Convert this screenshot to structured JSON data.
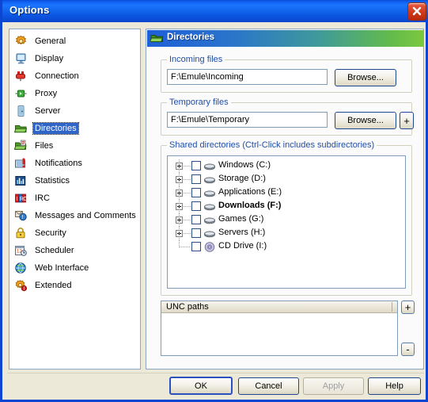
{
  "window": {
    "title": "Options",
    "close_icon": "close-x-icon"
  },
  "sidebar": {
    "items": [
      {
        "label": "General",
        "icon": "gear-icon",
        "selected": false
      },
      {
        "label": "Display",
        "icon": "monitor-icon",
        "selected": false
      },
      {
        "label": "Connection",
        "icon": "plug-icon",
        "selected": false
      },
      {
        "label": "Proxy",
        "icon": "proxy-icon",
        "selected": false
      },
      {
        "label": "Server",
        "icon": "server-icon",
        "selected": false
      },
      {
        "label": "Directories",
        "icon": "folder-icon",
        "selected": true
      },
      {
        "label": "Files",
        "icon": "files-icon",
        "selected": false
      },
      {
        "label": "Notifications",
        "icon": "notification-icon",
        "selected": false
      },
      {
        "label": "Statistics",
        "icon": "statistics-icon",
        "selected": false
      },
      {
        "label": "IRC",
        "icon": "irc-icon",
        "selected": false
      },
      {
        "label": "Messages and Comments",
        "icon": "messages-icon",
        "selected": false
      },
      {
        "label": "Security",
        "icon": "lock-icon",
        "selected": false
      },
      {
        "label": "Scheduler",
        "icon": "calendar-clock-icon",
        "selected": false
      },
      {
        "label": "Web Interface",
        "icon": "globe-icon",
        "selected": false
      },
      {
        "label": "Extended",
        "icon": "gear-alert-icon",
        "selected": false
      }
    ]
  },
  "panel": {
    "header": {
      "title": "Directories",
      "icon": "folder-icon"
    },
    "incoming": {
      "group_label": "Incoming files",
      "path_value": "F:\\Emule\\Incoming",
      "browse_label": "Browse..."
    },
    "temporary": {
      "group_label": "Temporary files",
      "path_value": "F:\\Emule\\Temporary",
      "browse_label": "Browse...",
      "add_label": "+"
    },
    "shared": {
      "group_label": "Shared directories (Ctrl-Click includes subdirectories)",
      "tree": [
        {
          "label": "Windows (C:)",
          "icon": "hard-drive-icon",
          "checked": false,
          "expandable": true,
          "bold": false,
          "last": false
        },
        {
          "label": "Storage (D:)",
          "icon": "hard-drive-icon",
          "checked": false,
          "expandable": true,
          "bold": false,
          "last": false
        },
        {
          "label": "Applications (E:)",
          "icon": "hard-drive-icon",
          "checked": false,
          "expandable": true,
          "bold": false,
          "last": false
        },
        {
          "label": "Downloads (F:)",
          "icon": "hard-drive-icon",
          "checked": false,
          "expandable": true,
          "bold": true,
          "last": false
        },
        {
          "label": "Games (G:)",
          "icon": "hard-drive-icon",
          "checked": false,
          "expandable": true,
          "bold": false,
          "last": false
        },
        {
          "label": "Servers (H:)",
          "icon": "hard-drive-icon",
          "checked": false,
          "expandable": true,
          "bold": false,
          "last": false
        },
        {
          "label": "CD Drive (I:)",
          "icon": "cd-drive-icon",
          "checked": false,
          "expandable": false,
          "bold": false,
          "last": true
        }
      ]
    },
    "unc": {
      "column_header": "UNC paths",
      "rows": [],
      "add_label": "+",
      "remove_label": "-"
    }
  },
  "footer": {
    "ok_label": "OK",
    "cancel_label": "Cancel",
    "apply_label": "Apply",
    "apply_disabled": true,
    "help_label": "Help"
  },
  "colors": {
    "titlebar_blue": "#1266ee",
    "window_border": "#0a46d2",
    "background": "#ece9d8",
    "panel_bg": "#fbfbfb",
    "group_label": "#1f4ea8",
    "selection_blue": "#2f64c8",
    "close_red": "#d23a1c"
  }
}
